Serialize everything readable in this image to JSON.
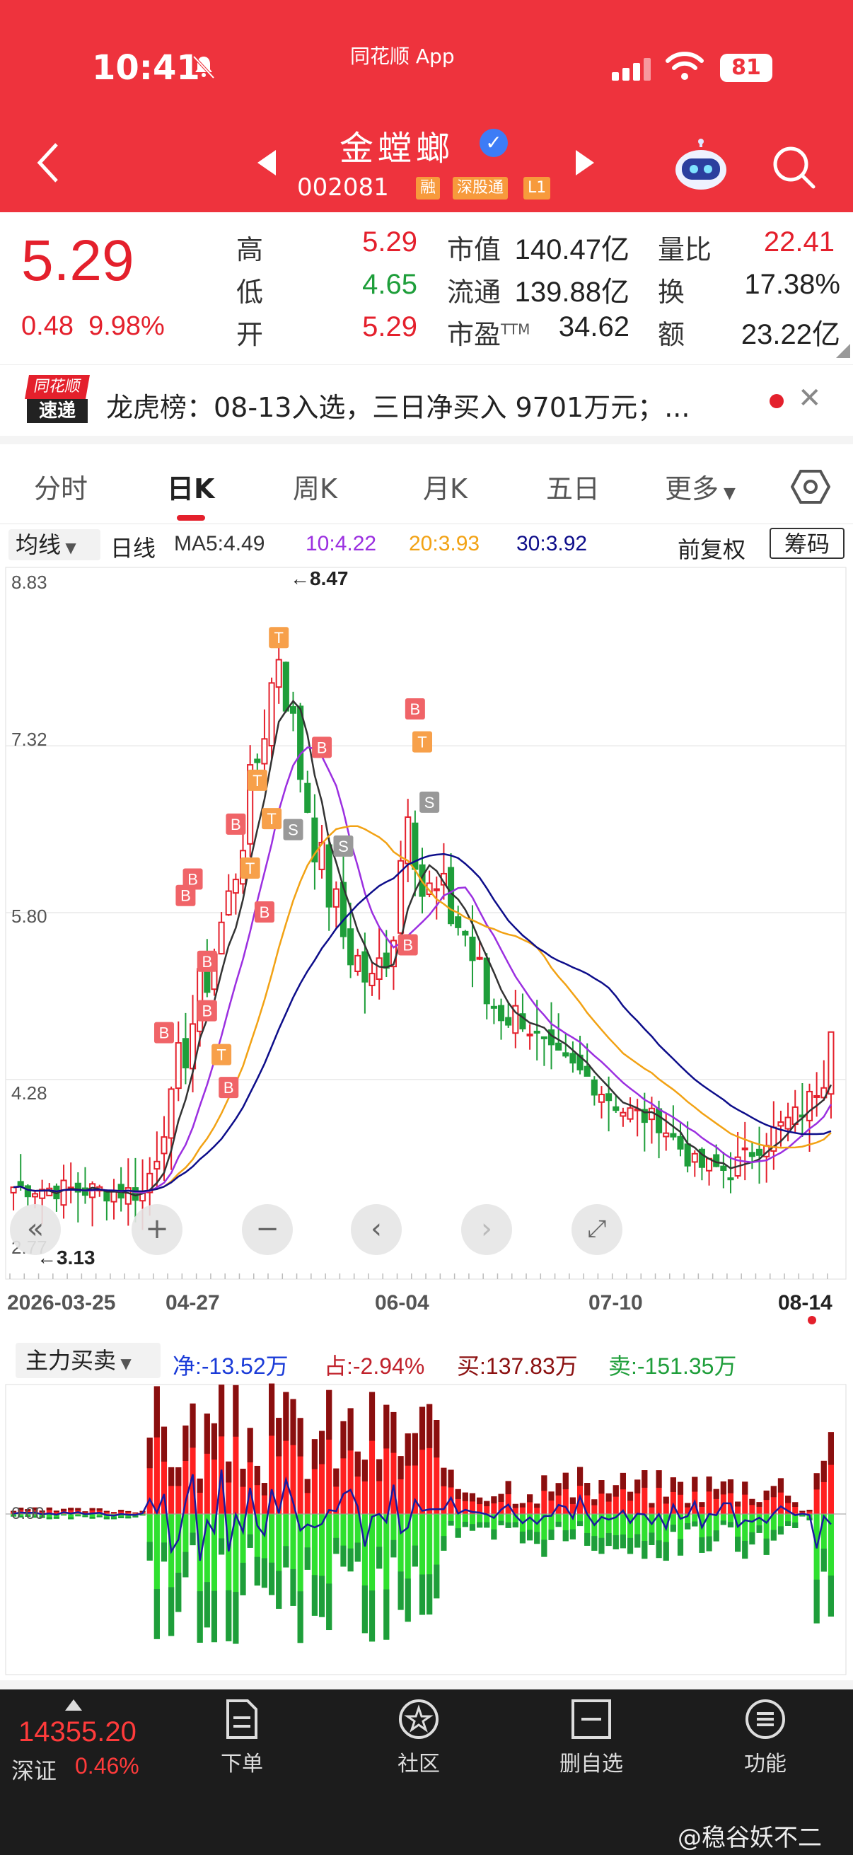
{
  "status": {
    "time": "10:41",
    "app": "同花顺 App",
    "battery": "81"
  },
  "header": {
    "stock_name": "金螳螂",
    "stock_code": "002081",
    "tags": [
      "融",
      "深股通",
      "L1"
    ]
  },
  "quote": {
    "price": "5.29",
    "change": "0.48",
    "change_pct": "9.98%",
    "high_label": "高",
    "high": "5.29",
    "low_label": "低",
    "low": "4.65",
    "open_label": "开",
    "open": "5.29",
    "mcap_label": "市值",
    "mcap": "140.47亿",
    "float_label": "流通",
    "float": "139.88亿",
    "pe_label": "市盈",
    "pe_sup": "TTM",
    "pe": "34.62",
    "vol_ratio_label": "量比",
    "vol_ratio": "22.41",
    "turnover_label": "换",
    "turnover": "17.38%",
    "amount_label": "额",
    "amount": "23.22亿"
  },
  "news": {
    "logo_top": "同花顺",
    "logo_bottom": "速递",
    "text": "龙虎榜：08-13入选，三日净买入 9701万元；..."
  },
  "tabs": [
    "分时",
    "日K",
    "周K",
    "月K",
    "五日",
    "更多"
  ],
  "ma_row": {
    "dropdown": "均线",
    "period": "日线",
    "ma5": "MA5:4.49",
    "ma10": "10:4.22",
    "ma20": "20:3.93",
    "ma30": "30:3.92",
    "adjust": "前复权",
    "chips": "筹码"
  },
  "colors": {
    "up": "#e4202c",
    "down": "#1e9e3a",
    "ma5": "#333333",
    "ma10": "#9b2fe0",
    "ma20": "#f2a214",
    "ma30": "#0d0d8a"
  },
  "chart_data": {
    "type": "candlestick",
    "y_ticks": [
      "8.83",
      "7.32",
      "5.80",
      "4.28",
      "2.77"
    ],
    "ylim": [
      2.77,
      8.83
    ],
    "x_ticks": [
      "2026-03-25",
      "04-27",
      "06-04",
      "07-10",
      "08-14"
    ],
    "max_annotation": "8.47",
    "min_annotation": "3.13",
    "markers": [
      "B",
      "T",
      "S"
    ]
  },
  "indicator": {
    "dropdown": "主力买卖",
    "net": "净:-13.52万",
    "ratio": "占:-2.94%",
    "buy": "买:137.83万",
    "sell": "卖:-151.35万",
    "zero": "0.00"
  },
  "bottom": {
    "index_value": "14355.20",
    "index_name": "深证",
    "index_pct": "0.46%",
    "nav": [
      "下单",
      "社区",
      "删自选",
      "功能"
    ]
  },
  "watermark": "@稳谷妖不二"
}
